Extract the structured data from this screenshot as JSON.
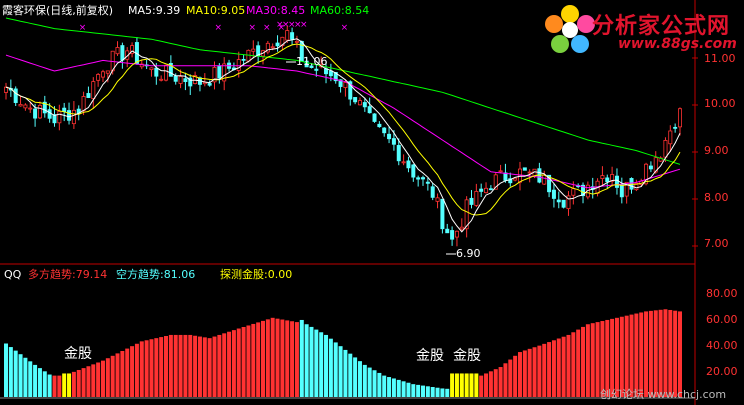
{
  "header": {
    "title": "霞客环保(日线,前复权)",
    "ma5": "MA5:9.39",
    "ma10": "MA10:9.05",
    "ma30": "MA30:8.45",
    "ma60": "MA60:8.54"
  },
  "colors": {
    "up": "#ff3232",
    "down": "#54ffff",
    "ma5": "#ffffff",
    "ma10": "#ffff00",
    "ma30": "#ff00ff",
    "ma60": "#00ff00",
    "axis": "#c00000",
    "gold": "#ffff00",
    "magenta": "#ff00ff"
  },
  "price_axis": {
    "ticks": [
      "11.00",
      "10.00",
      "9.00",
      "8.00",
      "7.00"
    ]
  },
  "annotations": {
    "high": "11.06",
    "low": "6.90"
  },
  "indicator": {
    "name": "QQ",
    "bull_label": "多方趋势:79.14",
    "bear_label": "空方趋势:81.06",
    "gold_label": "探测金股:0.00",
    "gold_marks": [
      "金股",
      "金股",
      "金股"
    ],
    "ticks": [
      "80.00",
      "60.00",
      "40.00",
      "20.00"
    ]
  },
  "logo": {
    "text": "分析家公式网",
    "url": "www.88gs.com"
  },
  "watermark": "创幻论坛 www.chcj.com",
  "chart_data": {
    "type": "candlestick",
    "ylim": [
      6.7,
      11.3
    ],
    "anchor_closes": [
      [
        0,
        10.0
      ],
      [
        5,
        9.6
      ],
      [
        10,
        9.4
      ],
      [
        15,
        9.6
      ],
      [
        20,
        10.4
      ],
      [
        25,
        10.7
      ],
      [
        30,
        10.3
      ],
      [
        35,
        10.2
      ],
      [
        40,
        10.1
      ],
      [
        45,
        10.3
      ],
      [
        50,
        10.6
      ],
      [
        55,
        10.9
      ],
      [
        58,
        11.0
      ],
      [
        62,
        10.4
      ],
      [
        68,
        10.2
      ],
      [
        72,
        9.8
      ],
      [
        76,
        9.2
      ],
      [
        80,
        8.9
      ],
      [
        84,
        8.4
      ],
      [
        88,
        8.0
      ],
      [
        90,
        7.5
      ],
      [
        92,
        7.1
      ],
      [
        95,
        7.7
      ],
      [
        100,
        8.2
      ],
      [
        105,
        8.4
      ],
      [
        110,
        8.3
      ],
      [
        115,
        7.9
      ],
      [
        118,
        8.0
      ],
      [
        122,
        8.3
      ],
      [
        125,
        8.4
      ],
      [
        127,
        8.0
      ],
      [
        130,
        8.3
      ],
      [
        135,
        8.8
      ],
      [
        138,
        9.4
      ],
      [
        139,
        9.5
      ]
    ],
    "indicator_ylim": [
      0,
      100
    ],
    "bull_trend": [
      [
        0,
        22
      ],
      [
        6,
        15
      ],
      [
        10,
        20
      ],
      [
        12,
        20
      ],
      [
        20,
        34
      ],
      [
        28,
        52
      ],
      [
        34,
        58
      ],
      [
        38,
        58
      ],
      [
        42,
        55
      ],
      [
        48,
        64
      ],
      [
        55,
        74
      ],
      [
        60,
        70
      ],
      [
        62,
        20
      ],
      [
        70,
        16
      ],
      [
        74,
        12
      ],
      [
        78,
        8
      ],
      [
        82,
        4
      ],
      [
        88,
        5
      ],
      [
        92,
        8
      ],
      [
        96,
        16
      ],
      [
        102,
        28
      ],
      [
        106,
        42
      ],
      [
        110,
        48
      ],
      [
        116,
        58
      ],
      [
        120,
        68
      ],
      [
        126,
        74
      ],
      [
        132,
        80
      ],
      [
        136,
        82
      ],
      [
        139,
        80
      ]
    ],
    "bear_trend": [
      [
        0,
        50
      ],
      [
        6,
        30
      ],
      [
        10,
        18
      ],
      [
        14,
        14
      ],
      [
        20,
        10
      ],
      [
        28,
        8
      ],
      [
        34,
        6
      ],
      [
        40,
        8
      ],
      [
        44,
        20
      ],
      [
        48,
        40
      ],
      [
        52,
        44
      ],
      [
        58,
        66
      ],
      [
        61,
        72
      ],
      [
        62,
        68
      ],
      [
        66,
        58
      ],
      [
        70,
        44
      ],
      [
        74,
        30
      ],
      [
        78,
        20
      ],
      [
        84,
        12
      ],
      [
        90,
        8
      ],
      [
        96,
        6
      ],
      [
        102,
        8
      ],
      [
        108,
        10
      ],
      [
        114,
        12
      ],
      [
        120,
        14
      ],
      [
        126,
        16
      ],
      [
        132,
        20
      ],
      [
        139,
        24
      ]
    ],
    "gold_ranges": [
      [
        12,
        13
      ],
      [
        92,
        97
      ]
    ],
    "ma30_anchor": [
      [
        0,
        10.6
      ],
      [
        10,
        10.3
      ],
      [
        20,
        10.5
      ],
      [
        30,
        10.4
      ],
      [
        40,
        10.4
      ],
      [
        50,
        10.4
      ],
      [
        60,
        10.3
      ],
      [
        70,
        10.1
      ],
      [
        80,
        9.6
      ],
      [
        90,
        9.0
      ],
      [
        100,
        8.4
      ],
      [
        110,
        8.3
      ],
      [
        120,
        8.1
      ],
      [
        130,
        8.2
      ],
      [
        139,
        8.45
      ]
    ],
    "ma60_anchor": [
      [
        0,
        11.3
      ],
      [
        10,
        11.1
      ],
      [
        20,
        11.0
      ],
      [
        30,
        10.9
      ],
      [
        40,
        10.7
      ],
      [
        50,
        10.6
      ],
      [
        60,
        10.5
      ],
      [
        70,
        10.3
      ],
      [
        80,
        10.1
      ],
      [
        90,
        9.9
      ],
      [
        100,
        9.6
      ],
      [
        110,
        9.3
      ],
      [
        120,
        9.0
      ],
      [
        130,
        8.8
      ],
      [
        139,
        8.54
      ]
    ]
  }
}
